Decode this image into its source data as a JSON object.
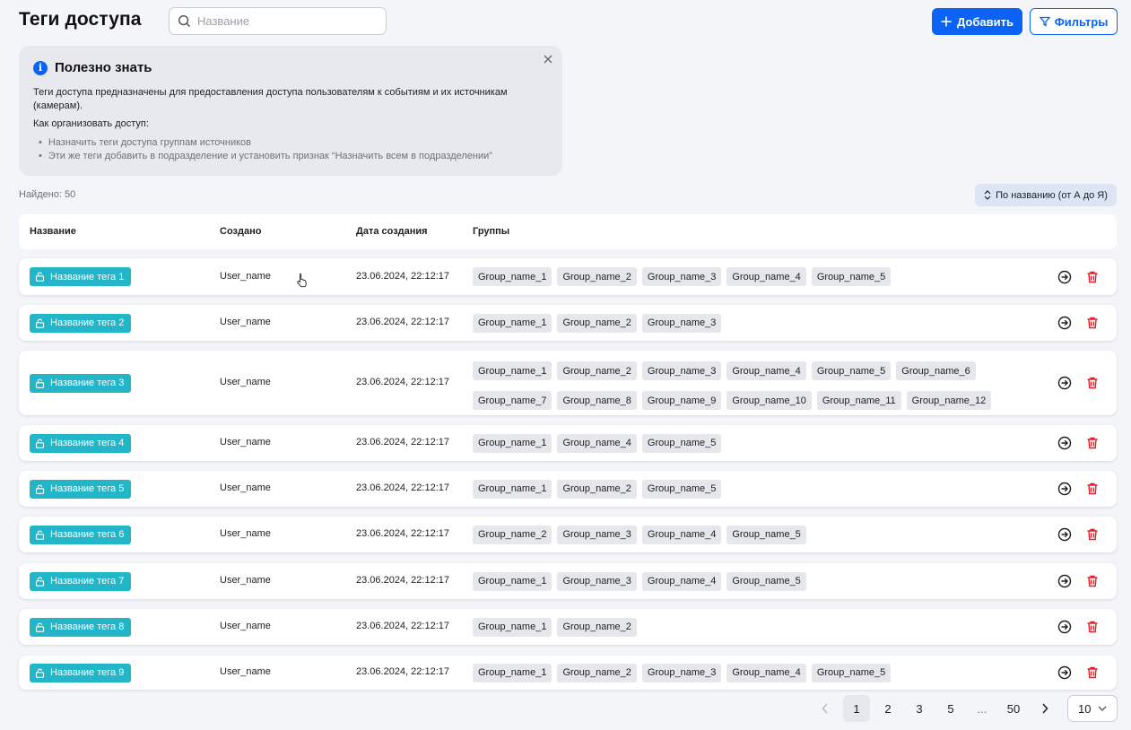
{
  "header": {
    "title": "Теги доступа",
    "search_placeholder": "Название",
    "add_label": "Добавить",
    "filters_label": "Фильтры"
  },
  "info": {
    "title": "Полезно знать",
    "text": "Теги доступа предназначены для предоставления доступа пользователям к событиям и их источникам (камерам).",
    "subtitle": "Как организовать доступ:",
    "items": [
      "Назначить теги доступа группам источников",
      "Эти же теги добавить в подразделение и установить признак “Назначить всем в подразделении”"
    ]
  },
  "found_label": "Найдено: 50",
  "sort_label": "По названию (от А до Я)",
  "table": {
    "columns": [
      "Название",
      "Создано",
      "Дата создания",
      "Группы"
    ],
    "rows": [
      {
        "tag": "Название тега 1",
        "creator": "User_name",
        "date": "23.06.2024, 22:12:17",
        "groups": [
          "Group_name_1",
          "Group_name_2",
          "Group_name_3",
          "Group_name_4",
          "Group_name_5"
        ]
      },
      {
        "tag": "Название тега  2",
        "creator": "User_name",
        "date": "23.06.2024, 22:12:17",
        "groups": [
          "Group_name_1",
          "Group_name_2",
          "Group_name_3"
        ]
      },
      {
        "tag": "Название тега  3",
        "creator": "User_name",
        "date": "23.06.2024, 22:12:17",
        "groups": [
          "Group_name_1",
          "Group_name_2",
          "Group_name_3",
          "Group_name_4",
          "Group_name_5",
          "Group_name_6",
          "Group_name_7",
          "Group_name_8",
          "Group_name_9",
          "Group_name_10",
          "Group_name_11",
          "Group_name_12"
        ]
      },
      {
        "tag": "Название тега  4",
        "creator": "User_name",
        "date": "23.06.2024, 22:12:17",
        "groups": [
          "Group_name_1",
          "Group_name_4",
          "Group_name_5"
        ]
      },
      {
        "tag": "Название тега  5",
        "creator": "User_name",
        "date": "23.06.2024, 22:12:17",
        "groups": [
          "Group_name_1",
          "Group_name_2",
          "Group_name_5"
        ]
      },
      {
        "tag": "Название тега  6",
        "creator": "User_name",
        "date": "23.06.2024, 22:12:17",
        "groups": [
          "Group_name_2",
          "Group_name_3",
          "Group_name_4",
          "Group_name_5"
        ]
      },
      {
        "tag": "Название тега  7",
        "creator": "User_name",
        "date": "23.06.2024, 22:12:17",
        "groups": [
          "Group_name_1",
          "Group_name_3",
          "Group_name_4",
          "Group_name_5"
        ]
      },
      {
        "tag": "Название тега  8",
        "creator": "User_name",
        "date": "23.06.2024, 22:12:17",
        "groups": [
          "Group_name_1",
          "Group_name_2"
        ]
      },
      {
        "tag": "Название тега  9",
        "creator": "User_name",
        "date": "23.06.2024, 22:12:17",
        "groups": [
          "Group_name_1",
          "Group_name_2",
          "Group_name_3",
          "Group_name_4",
          "Group_name_5"
        ]
      }
    ]
  },
  "pagination": {
    "pages": [
      "1",
      "2",
      "3",
      "5",
      "...",
      "50"
    ],
    "current": "1",
    "per_page": "10"
  },
  "colors": {
    "accent": "#0b63f6",
    "tag": "#22b6c8",
    "delete": "#e0202a"
  }
}
